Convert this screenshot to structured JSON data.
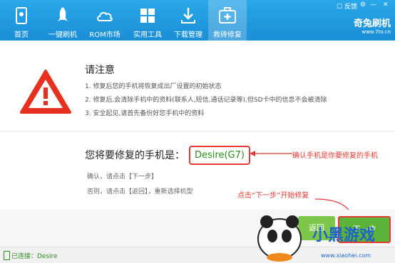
{
  "nav": {
    "items": [
      {
        "label": "首页"
      },
      {
        "label": "一键刷机"
      },
      {
        "label": "ROM市场"
      },
      {
        "label": "实用工具"
      },
      {
        "label": "下载管理"
      },
      {
        "label": "救砖修复"
      }
    ],
    "feedback": "反馈",
    "brand_name": "奇兔刷机",
    "brand_url": "www.7to.cn"
  },
  "warning": {
    "title": "请注意",
    "items": [
      "1. 修复后您的手机将恢复成出厂设置的初始状态",
      "2. 修复后,会清除手机中的资料(联系人,短信,通话记录等),但SD卡中的信息不会被清除",
      "3. 安全起见,请首先备份好您手机中的资料"
    ]
  },
  "confirm": {
    "label": "您将要修复的手机是：",
    "model": "Desire(G7)",
    "hint_confirm": "确认，请点击【下一步】",
    "hint_deny": "否则，请点击【返回】，重新选择机型"
  },
  "annotations": {
    "confirm_phone": "确认手机是你要修复的手机",
    "click_next": "点击“下一步”开始修复"
  },
  "buttons": {
    "back": "返回",
    "next": "下一步"
  },
  "status": {
    "connected": "已连接：Desire"
  },
  "watermark": {
    "text": "小黑游戏",
    "url": "www.xiaohei.com"
  },
  "colors": {
    "nav_bg": "#1a8ed6",
    "accent_green": "#5db33a",
    "annotation_red": "#e53935",
    "model_text": "#2e8b1f"
  }
}
